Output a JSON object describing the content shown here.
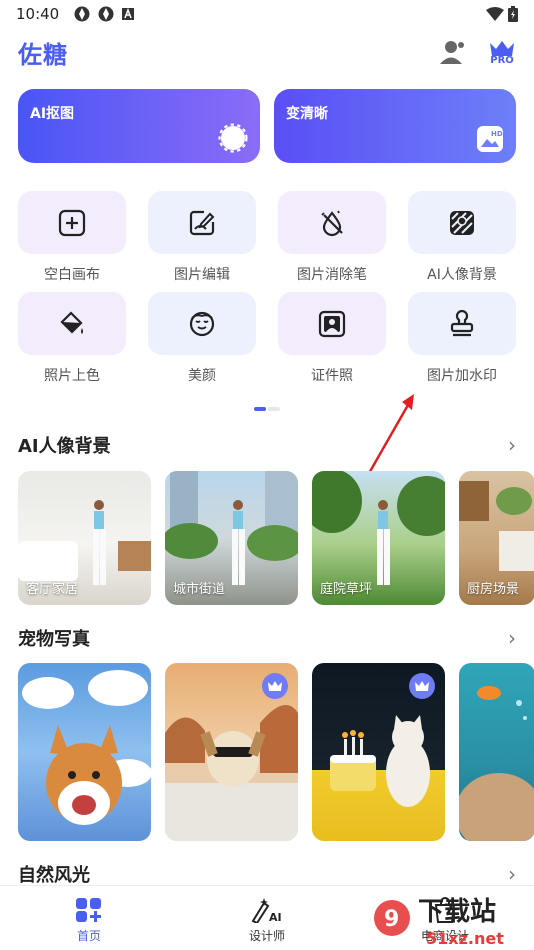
{
  "status_bar": {
    "time": "10:40"
  },
  "header": {
    "title": "佐糖",
    "pro_label": "PRO"
  },
  "big_cards": [
    {
      "label": "AI抠图"
    },
    {
      "label": "变清晰"
    }
  ],
  "tools": [
    {
      "label": "空白画布",
      "icon": "plus-square-icon"
    },
    {
      "label": "图片编辑",
      "icon": "photo-edit-icon"
    },
    {
      "label": "图片消除笔",
      "icon": "eraser-drop-icon"
    },
    {
      "label": "AI人像背景",
      "icon": "portrait-background-icon"
    },
    {
      "label": "照片上色",
      "icon": "paint-bucket-icon"
    },
    {
      "label": "美颜",
      "icon": "beauty-face-icon"
    },
    {
      "label": "证件照",
      "icon": "id-photo-icon"
    },
    {
      "label": "图片加水印",
      "icon": "stamp-icon"
    }
  ],
  "sections": {
    "portrait_bg": {
      "title": "AI人像背景",
      "items": [
        "客厅家居",
        "城市街道",
        "庭院草坪",
        "厨房场景"
      ]
    },
    "pet": {
      "title": "宠物写真"
    },
    "nature": {
      "title": "自然风光"
    }
  },
  "bottom_nav": [
    {
      "label": "首页"
    },
    {
      "label": "设计师"
    },
    {
      "label": "电商设计"
    }
  ],
  "watermark": {
    "brand": "下载站",
    "domain": "51xz.net"
  },
  "colors": {
    "accent": "#4a5ef2",
    "tool_purple": "#f3ecfd",
    "tool_blue": "#ecf1fd",
    "annotation": "#e02020"
  }
}
